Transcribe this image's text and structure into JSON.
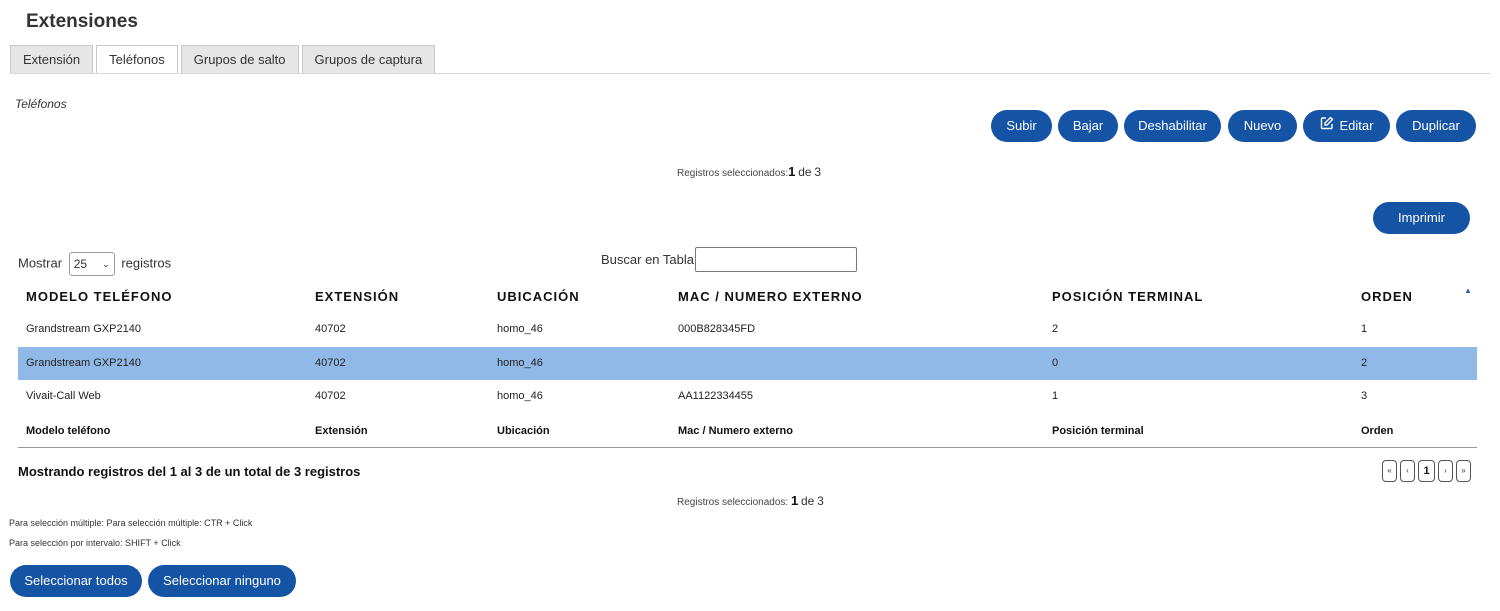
{
  "page_title": "Extensiones",
  "tabs": [
    {
      "label": "Extensión",
      "active": false
    },
    {
      "label": "Teléfonos",
      "active": true
    },
    {
      "label": "Grupos de salto",
      "active": false
    },
    {
      "label": "Grupos de captura",
      "active": false
    }
  ],
  "section_label": "Teléfonos",
  "toolbar": {
    "subir": "Subir",
    "bajar": "Bajar",
    "deshabilitar": "Deshabilitar",
    "nuevo": "Nuevo",
    "editar": "Editar",
    "duplicar": "Duplicar",
    "imprimir": "Imprimir"
  },
  "selection_top": {
    "label": "Registros seleccionados:",
    "count": "1",
    "of_word": "de",
    "total": "3"
  },
  "length_control": {
    "prefix": "Mostrar",
    "value": "25",
    "suffix": "registros"
  },
  "search": {
    "label": "Buscar en Tabla:",
    "value": ""
  },
  "table": {
    "headers": [
      "MODELO TELÉFONO",
      "EXTENSIÓN",
      "UBICACIÓN",
      "MAC / NUMERO EXTERNO",
      "POSICIÓN TERMINAL",
      "ORDEN"
    ],
    "footers": [
      "Modelo teléfono",
      "Extensión",
      "Ubicación",
      "Mac / Numero externo",
      "Posición terminal",
      "Orden"
    ],
    "rows": [
      {
        "model": "Grandstream GXP2140",
        "extension": "40702",
        "location": "homo_46",
        "mac": "000B828345FD",
        "position": "2",
        "order": "1",
        "selected": false
      },
      {
        "model": "Grandstream GXP2140",
        "extension": "40702",
        "location": "homo_46",
        "mac": "",
        "position": "0",
        "order": "2",
        "selected": true
      },
      {
        "model": "Vivait-Call Web",
        "extension": "40702",
        "location": "homo_46",
        "mac": "AA1122334455",
        "position": "1",
        "order": "3",
        "selected": false
      }
    ]
  },
  "info_text": "Mostrando registros del 1 al 3 de un total de 3 registros",
  "pagination": {
    "first": "«",
    "prev": "‹",
    "current": "1",
    "next": "›",
    "last": "»"
  },
  "selection_bottom": {
    "label": "Registros seleccionados: ",
    "count": "1",
    "of_word": "de",
    "total": "3"
  },
  "hints": {
    "multiple": "Para selección múltiple: Para selección múltiple: CTR + Click",
    "interval": "Para selección por intervalo: SHIFT + Click"
  },
  "bottom_buttons": {
    "select_all": "Seleccionar todos",
    "select_none": "Seleccionar ninguno"
  },
  "colors": {
    "button": "#1553a5",
    "selected_row": "#91b9e8",
    "sort_arrow": "#2d5fa8"
  }
}
